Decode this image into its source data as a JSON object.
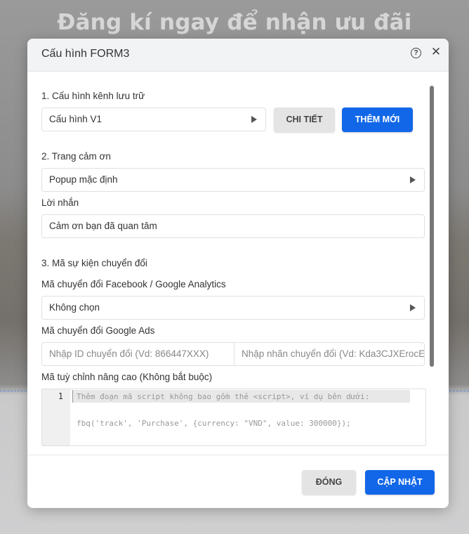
{
  "background": {
    "heading": "Đăng kí ngay để nhận ưu đãi"
  },
  "modal": {
    "title": "Cấu hình FORM3",
    "help_icon": "?",
    "close_icon": "✕"
  },
  "section1": {
    "label": "1. Cấu hình kênh lưu trữ",
    "select_value": "Cấu hình V1",
    "detail_button": "CHI TIẾT",
    "add_button": "THÊM MỚI"
  },
  "section2": {
    "label": "2. Trang cảm ơn",
    "select_value": "Popup mặc định",
    "message_label": "Lời nhắn",
    "message_value": "Cảm ơn bạn đã quan tâm"
  },
  "section3": {
    "label": "3. Mã sự kiện chuyển đổi",
    "fb_ga_label": "Mã chuyển đổi Facebook / Google Analytics",
    "fb_ga_value": "Không chọn",
    "gads_label": "Mã chuyển đổi Google Ads",
    "gads_id_placeholder": "Nhập ID chuyển đổi (Vd: 866447XXX)",
    "gads_label_placeholder": "Nhập nhãn chuyển đổi (Vd: Kda3CJXErocE",
    "custom_label": "Mã tuỳ chỉnh nâng cao (Không bắt buộc)",
    "code_line_number": "1",
    "code_line_1": "Thêm đoạn mã script không bao gồm thẻ <script>, ví dụ bên dưới:",
    "code_line_2": "fbq('track', 'Purchase', {currency: \"VND\", value: 300000});"
  },
  "footer": {
    "close_button": "ĐÓNG",
    "update_button": "CẬP NHẬT"
  },
  "colors": {
    "primary": "#1167e8",
    "secondary_button": "#e4e4e4"
  }
}
